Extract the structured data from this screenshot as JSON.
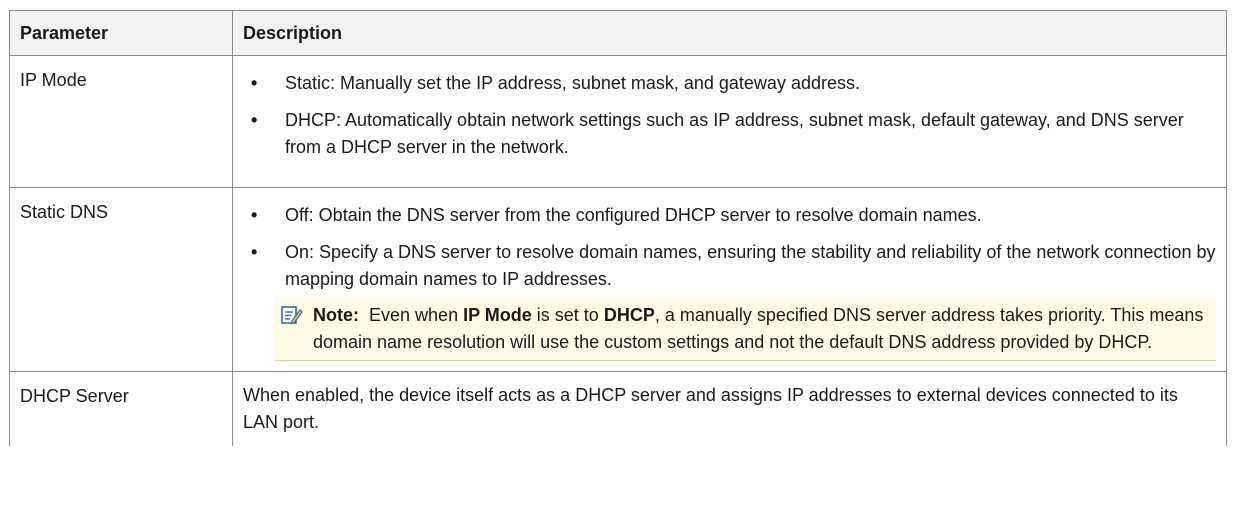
{
  "table": {
    "headers": {
      "parameter": "Parameter",
      "description": "Description"
    },
    "rows": {
      "ip_mode": {
        "parameter": "IP Mode",
        "bullets": [
          "Static: Manually set the IP address, subnet mask, and gateway address.",
          "DHCP: Automatically obtain network settings such as IP address, subnet mask, default gateway, and DNS server from a DHCP server in the network."
        ]
      },
      "static_dns": {
        "parameter": "Static DNS",
        "bullets": [
          "Off: Obtain the DNS server from the configured DHCP server to resolve domain names.",
          "On: Specify a DNS server to resolve domain names, ensuring the stability and reliability of the network connection by mapping domain names to IP addresses."
        ],
        "note": {
          "label": "Note:",
          "part1": "Even when",
          "bold1": "IP Mode",
          "part2": "is set to",
          "bold2": "DHCP",
          "part3": ", a manually specified DNS server address takes priority. This means domain name resolution will use the custom settings and not the default DNS address provided by DHCP."
        }
      },
      "dhcp_server": {
        "parameter": "DHCP Server",
        "description": "When enabled, the device itself acts as a DHCP server and assigns IP addresses to external devices connected to its LAN port."
      }
    },
    "bullet_symbol": "•"
  },
  "colors": {
    "header_bg": "#f2f2f2",
    "border": "#8c8c8c",
    "note_bg": "#fefde3",
    "note_icon": "#2a6fb5"
  },
  "icons": {
    "note": "note-pencil-icon"
  }
}
